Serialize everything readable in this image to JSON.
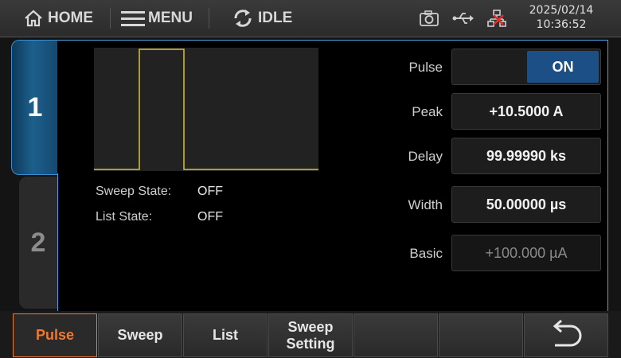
{
  "topbar": {
    "home_label": "HOME",
    "menu_label": "MENU",
    "status_label": "IDLE",
    "date": "2025/02/14",
    "time": "10:36:52"
  },
  "tabs": [
    {
      "label": "1"
    },
    {
      "label": "2"
    }
  ],
  "waveform": {
    "line_color": "#d8c33a",
    "background": "#222222"
  },
  "states": {
    "sweep_label": "Sweep State:",
    "sweep_value": "OFF",
    "list_label": "List State:",
    "list_value": "OFF"
  },
  "params": {
    "pulse_label": "Pulse",
    "pulse_value": "ON",
    "peak_label": "Peak",
    "peak_value": "+10.5000 A",
    "delay_label": "Delay",
    "delay_value": "99.99990 ks",
    "width_label": "Width",
    "width_value": "50.00000 µs",
    "basic_label": "Basic",
    "basic_value": "+100.000 µA"
  },
  "softkeys": [
    {
      "label": "Pulse",
      "active": true
    },
    {
      "label": "Sweep"
    },
    {
      "label": "List"
    },
    {
      "label": "Sweep Setting"
    },
    {
      "label": ""
    },
    {
      "label": ""
    },
    {
      "label": "back-arrow-icon"
    }
  ],
  "colors": {
    "accent": "#4aa0e0",
    "active_key": "#f07830",
    "toggle_on": "#1c4f86"
  }
}
